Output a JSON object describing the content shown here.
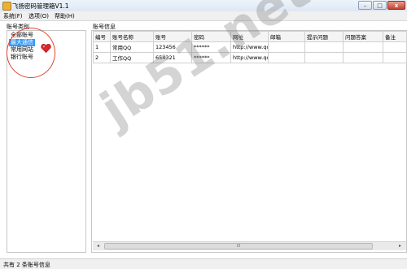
{
  "window": {
    "title": "飞扬密码管理箱V1.1",
    "min": "–",
    "max": "□",
    "close": "x"
  },
  "menu": {
    "items": [
      "系统(F)",
      "选项(O)",
      "帮助(H)"
    ]
  },
  "categories": {
    "label": "账号类别",
    "items": [
      "全部账号",
      "最大通信",
      "常用网站",
      "银行账号"
    ],
    "selected_index": 1
  },
  "accounts": {
    "label": "账号信息",
    "columns": [
      "编号",
      "账号名称",
      "账号",
      "密码",
      "网址",
      "邮箱",
      "提示问题",
      "问题答案",
      "备注"
    ],
    "rows": [
      [
        "1",
        "常用QQ",
        "123456",
        "******",
        "http://www.qq",
        "",
        "",
        "",
        ""
      ],
      [
        "2",
        "工作QQ",
        "654321",
        "******",
        "http://www.qq",
        "",
        "",
        "",
        ""
      ]
    ],
    "scroll_left": "◂",
    "scroll_right": "▸",
    "scroll_grip": "III"
  },
  "status": {
    "text": "共有 2 条账号信息"
  },
  "watermark": "jb51.net",
  "colors": {
    "selection": "#3399ff",
    "annotation": "#e0442f",
    "heart": "#d9262b"
  }
}
